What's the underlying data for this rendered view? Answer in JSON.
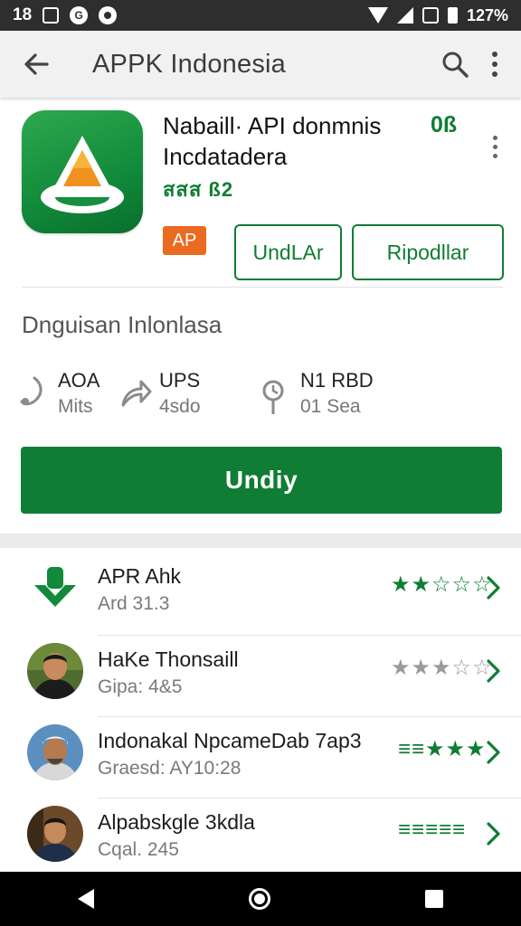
{
  "status_bar": {
    "time": "18",
    "battery_text": "127%"
  },
  "app_bar": {
    "title": "APPK Indonesia"
  },
  "app": {
    "name_line1": "Nabaill· API donmnis",
    "name_line2": "Incdatadera",
    "badge": "0ß",
    "rating_line": "สสส ß2",
    "chip": "AP",
    "button_1": "UndLAr",
    "button_2": "Ripodllar",
    "section_title": "Dnguisan Inlonlasa",
    "stats": [
      {
        "value": "AOA",
        "label": "Mits",
        "icon": "music-note-icon"
      },
      {
        "value": "UPS",
        "label": "4sdo",
        "icon": "share-arrow-icon"
      },
      {
        "value": "N1 RBD",
        "label": "01 Sea",
        "icon": "clock-pin-icon"
      }
    ],
    "install_label": "Undiy"
  },
  "reviews": [
    {
      "title": "APR Ahk",
      "subtitle": "Ard 31.3",
      "stars": "★★☆☆☆",
      "star_color": "#0f7d33",
      "avatar": "download-icon"
    },
    {
      "title": "HaKe Thonsaill",
      "subtitle": "Gipa: 4&5",
      "stars": "★★★☆☆",
      "star_color": "#9a9a9a",
      "avatar": "person-avatar"
    },
    {
      "title": "Indonakal NpcameDab 7ap3",
      "subtitle": "Graesd: AY10:28",
      "stars": "≡≡★★★",
      "star_color": "#0f7d33",
      "avatar": "person-avatar"
    },
    {
      "title": "Alpabskgle 3kdla",
      "subtitle": "Cqal. 245",
      "stars": "≡≡≡≡≡",
      "star_color": "#0f7d33",
      "avatar": "person-avatar"
    }
  ],
  "colors": {
    "accent": "#0f7d33",
    "chip": "#ea6a1f",
    "status_bar": "#2e2e2e",
    "app_bar": "#f1f1f1"
  }
}
